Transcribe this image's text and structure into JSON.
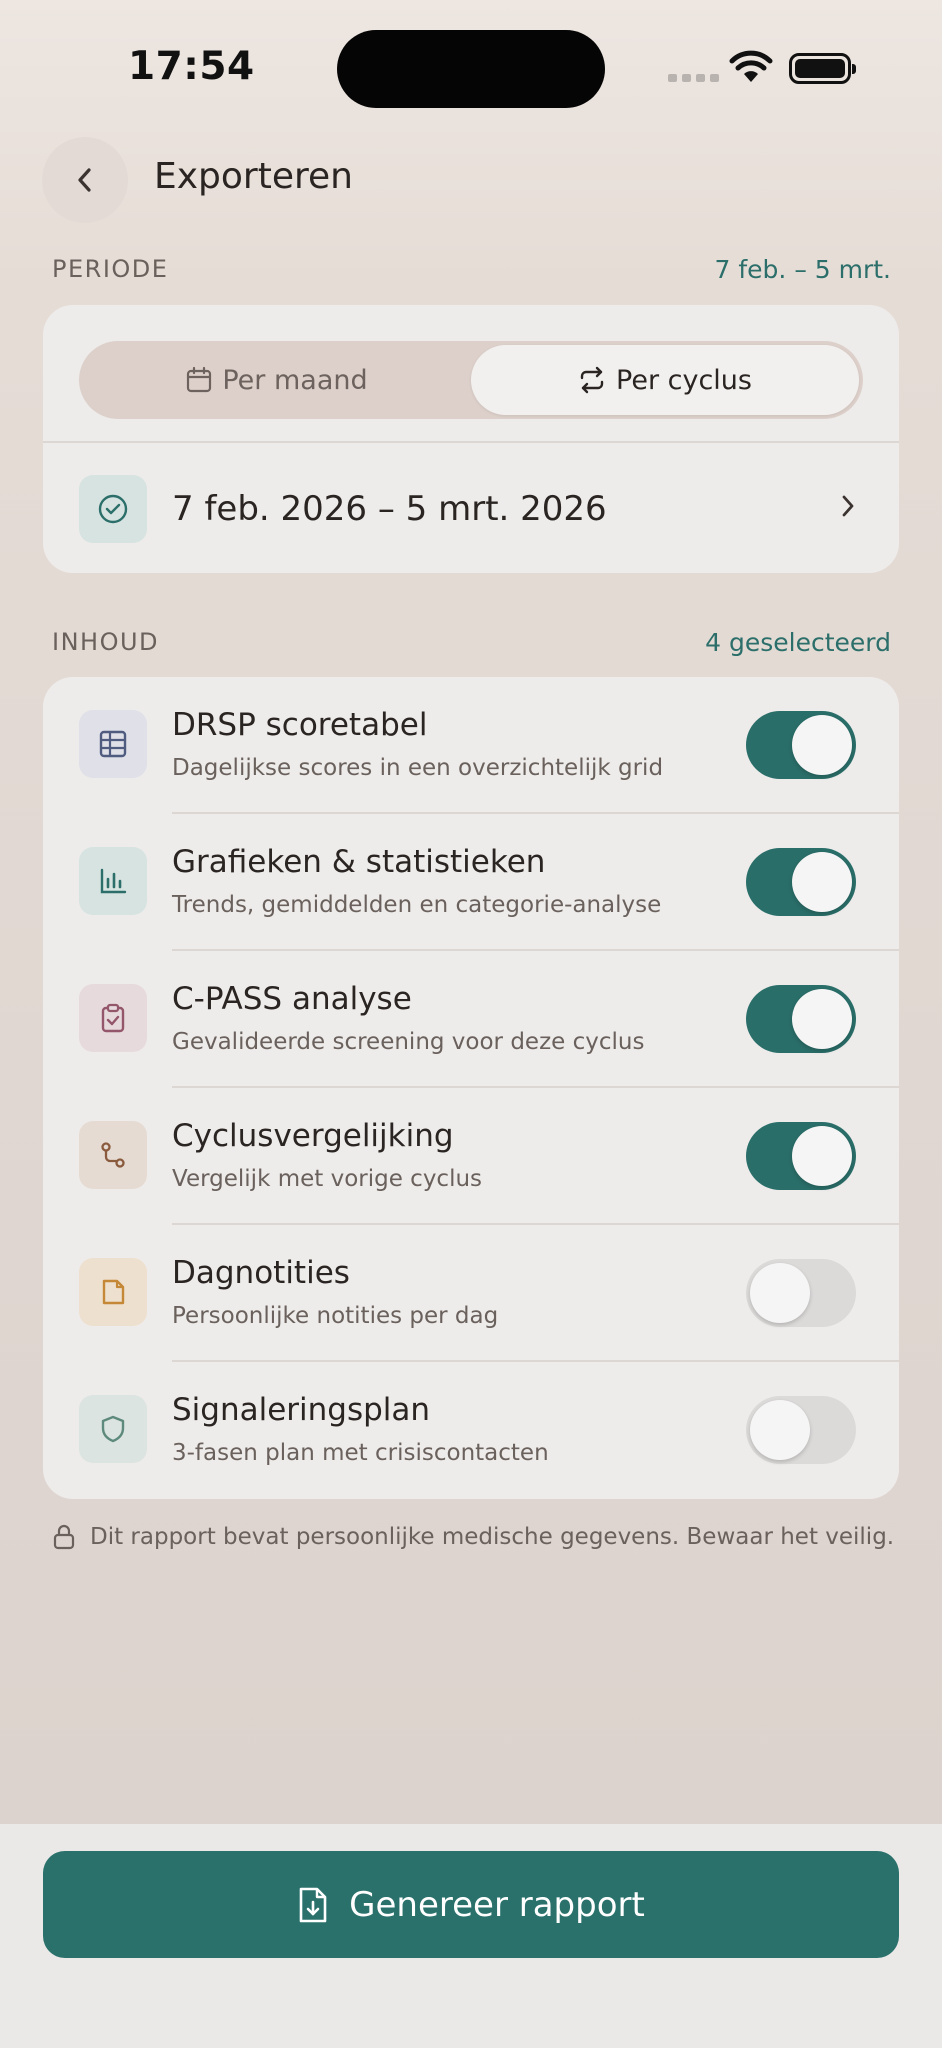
{
  "status_bar": {
    "time": "17:54"
  },
  "header": {
    "title": "Exporteren"
  },
  "period": {
    "section_label": "PERIODE",
    "summary": "7 feb. – 5 mrt.",
    "segments": [
      {
        "label": "Per maand",
        "icon": "calendar-icon",
        "selected": false
      },
      {
        "label": "Per cyclus",
        "icon": "repeat-icon",
        "selected": true
      }
    ],
    "range": "7 feb. 2026 – 5 mrt. 2026"
  },
  "content": {
    "section_label": "INHOUD",
    "selected_count": "4 geselecteerd",
    "items": [
      {
        "title": "DRSP scoretabel",
        "subtitle": "Dagelijkse scores in een overzichtelijk grid",
        "icon": "table-grid-icon",
        "enabled": true
      },
      {
        "title": "Grafieken & statistieken",
        "subtitle": "Trends, gemiddelden en categorie-analyse",
        "icon": "bar-chart-icon",
        "enabled": true
      },
      {
        "title": "C-PASS analyse",
        "subtitle": "Gevalideerde screening voor deze cyclus",
        "icon": "clipboard-check-icon",
        "enabled": true
      },
      {
        "title": "Cyclusvergelijking",
        "subtitle": "Vergelijk met vorige cyclus",
        "icon": "compare-path-icon",
        "enabled": true
      },
      {
        "title": "Dagnotities",
        "subtitle": "Persoonlijke notities per dag",
        "icon": "note-icon",
        "enabled": false
      },
      {
        "title": "Signaleringsplan",
        "subtitle": "3-fasen plan met crisiscontacten",
        "icon": "shield-icon",
        "enabled": false
      }
    ]
  },
  "privacy_note": "Dit rapport bevat persoonlijke medische gegevens. Bewaar het veilig.",
  "cta": {
    "label": "Genereer rapport",
    "icon": "file-download-icon"
  },
  "colors": {
    "accent": "#2a716c",
    "background": "#e3d9d4",
    "card": "#eeeceb"
  }
}
